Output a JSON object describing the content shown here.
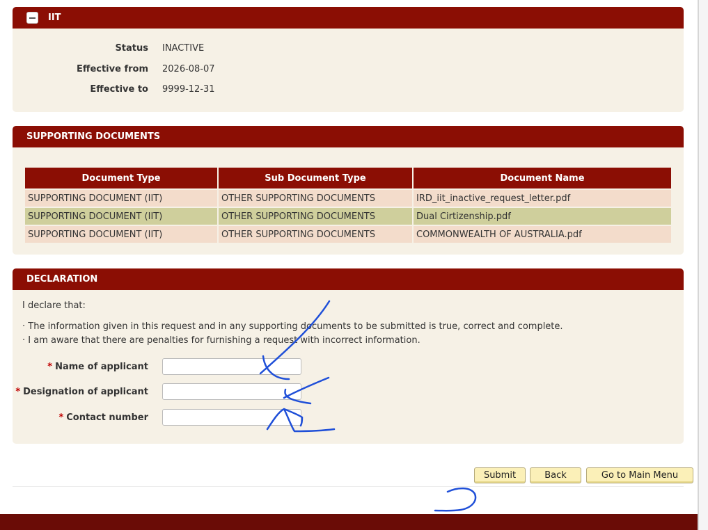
{
  "iit_panel": {
    "title": "IIT",
    "fields": [
      {
        "label": "Status",
        "value": "INACTIVE"
      },
      {
        "label": "Effective from",
        "value": "2026-08-07"
      },
      {
        "label": "Effective to",
        "value": "9999-12-31"
      }
    ]
  },
  "supporting_documents": {
    "title": "SUPPORTING DOCUMENTS",
    "columns": [
      "Document Type",
      "Sub Document Type",
      "Document Name"
    ],
    "rows": [
      [
        "SUPPORTING DOCUMENT (IIT)",
        "OTHER SUPPORTING DOCUMENTS",
        "IRD_iit_inactive_request_letter.pdf"
      ],
      [
        "SUPPORTING DOCUMENT (IIT)",
        "OTHER SUPPORTING DOCUMENTS",
        "Dual Cirtizenship.pdf"
      ],
      [
        "SUPPORTING DOCUMENT (IIT)",
        "OTHER SUPPORTING DOCUMENTS",
        "COMMONWEALTH OF AUSTRALIA.pdf"
      ]
    ]
  },
  "declaration": {
    "title": "DECLARATION",
    "intro": "I declare that:",
    "statements": [
      "· The information given in this request and in any supporting documents to be submitted is true, correct and complete.",
      "· I am aware that there are penalties for furnishing a request with incorrect information."
    ],
    "required_mark": "*",
    "fields": [
      {
        "label": "Name of applicant",
        "value": ""
      },
      {
        "label": "Designation of applicant",
        "value": ""
      },
      {
        "label": "Contact number",
        "value": ""
      }
    ]
  },
  "actions": {
    "submit": "Submit",
    "back": "Back",
    "main_menu": "Go to Main Menu"
  },
  "colors": {
    "header_red": "#8b0e04",
    "panel_bg": "#f6f1e6",
    "row_odd": "#f3dccb",
    "row_even": "#cfcf9c",
    "button_bg": "#fbf0b8",
    "ink_blue": "#1f4fd8",
    "footer": "#6a0c06"
  }
}
